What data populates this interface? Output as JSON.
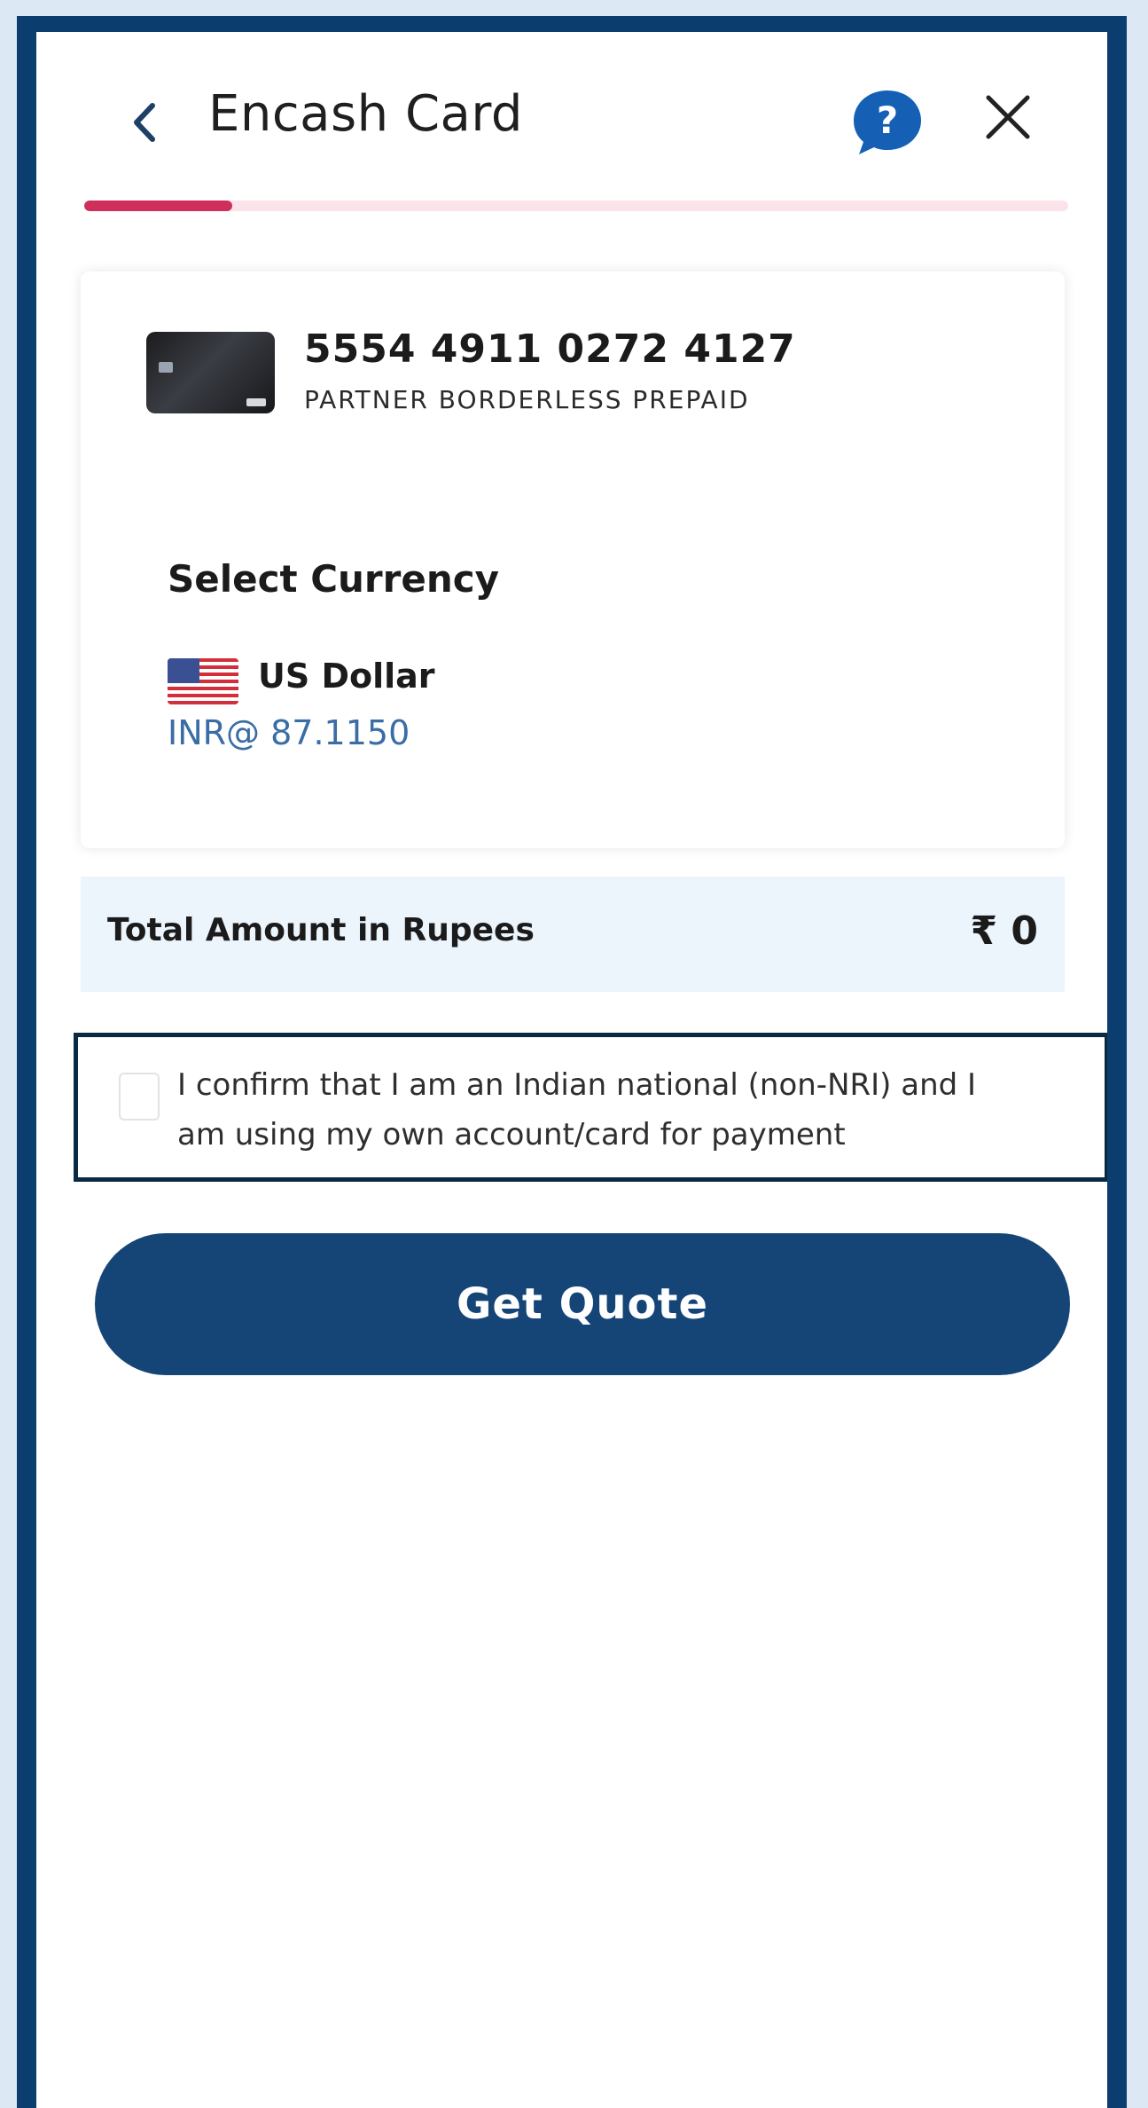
{
  "header": {
    "title": "Encash Card",
    "back_icon": "chevron-left-icon",
    "help_icon": "help-chat-icon",
    "help_symbol": "?",
    "close_icon": "close-icon",
    "progress_fraction": 0.15,
    "progress_color": "#cf2f5a",
    "progress_track_color": "#fbe4e9"
  },
  "card": {
    "number": "5554 4911 0272 4127",
    "name": "PARTNER BORDERLESS PREPAID"
  },
  "currency": {
    "section_title": "Select Currency",
    "items": [
      {
        "name": "US Dollar",
        "rate": "INR@ 87.1150",
        "flag_icon": "us-flag-icon"
      }
    ]
  },
  "total": {
    "label": "Total Amount in Rupees",
    "value": "₹ 0"
  },
  "consent": {
    "line1": "I confirm that I am an Indian national (non-NRI) and I",
    "line2": "am using my own account/card for payment",
    "checked": false
  },
  "actions": {
    "get_quote_label": "Get Quote"
  },
  "colors": {
    "primary": "#154577",
    "frame": "#0b3d6e",
    "accent": "#cf2f5a",
    "total_bg": "#ecf4fc"
  }
}
